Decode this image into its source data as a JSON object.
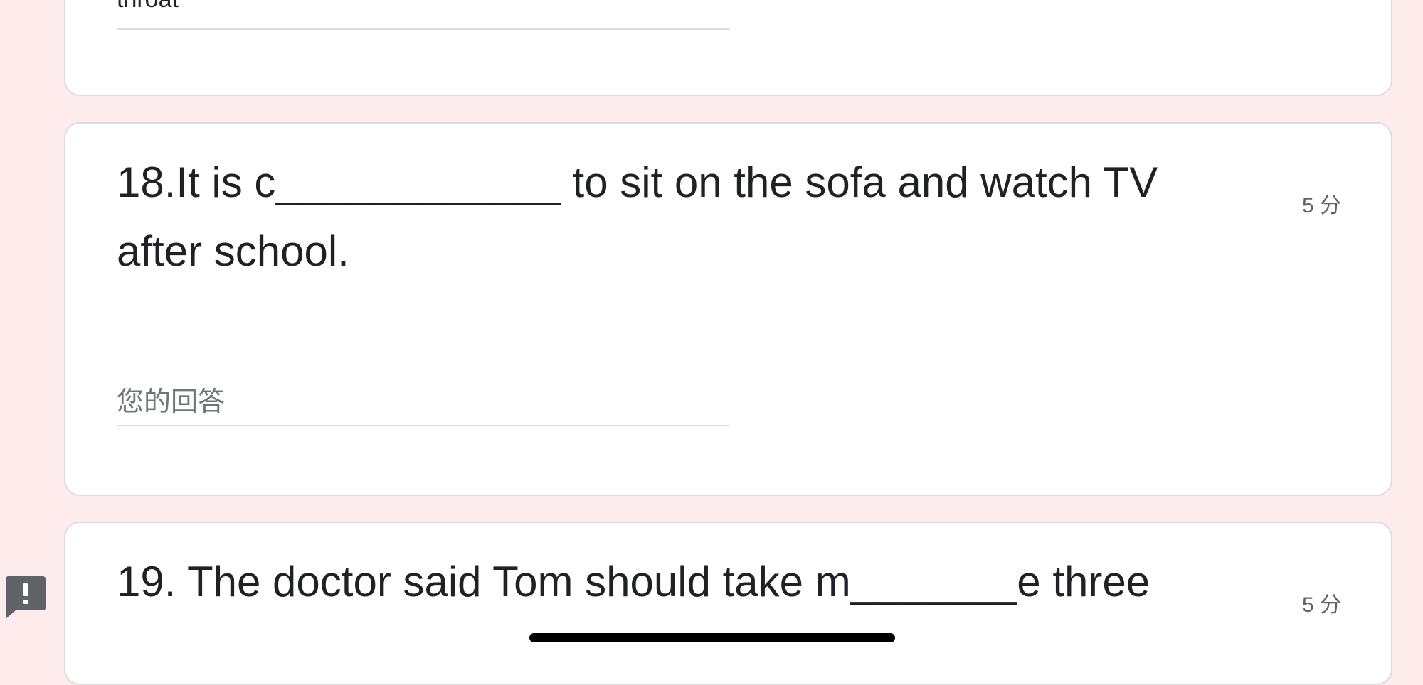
{
  "previous_question": {
    "answer_value": "throat"
  },
  "questions": [
    {
      "text": "18.It is c____________  to sit on the sofa and watch TV after school.",
      "points": "5 分",
      "answer_placeholder": "您的回答"
    },
    {
      "text": "19.  The doctor said Tom should take m_______e three",
      "points": "5 分"
    }
  ],
  "icons": {
    "feedback": "feedback-icon"
  },
  "colors": {
    "page_background": "#fdeceb",
    "card_background": "#ffffff",
    "card_border": "#dadce0",
    "feedback_icon": "#5f6368"
  }
}
